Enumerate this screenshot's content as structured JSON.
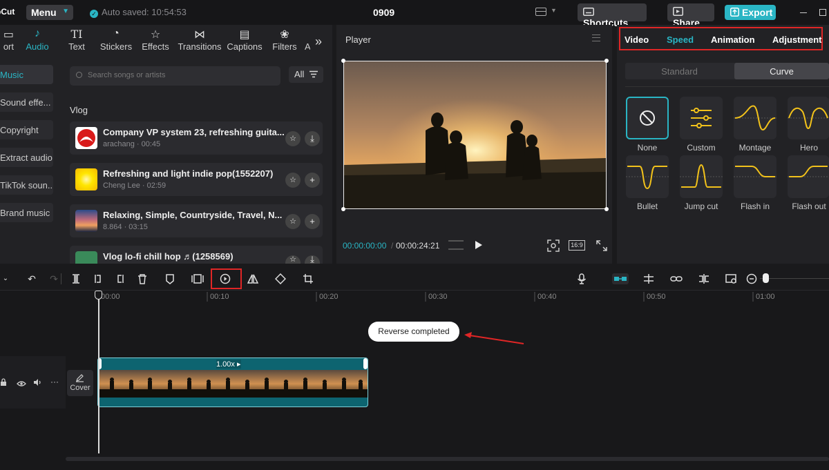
{
  "app": {
    "logo_text": "pCut",
    "project_name": "0909"
  },
  "topbar": {
    "menu_label": "Menu",
    "autosave": "Auto saved: 10:54:53",
    "shortcuts_label": "Shortcuts",
    "share_label": "Share",
    "export_label": "Export"
  },
  "left_tabs": [
    {
      "label": "ort",
      "icon": "import-icon"
    },
    {
      "label": "Audio",
      "icon": "audio-icon",
      "active": true
    },
    {
      "label": "Text",
      "icon": "text-icon"
    },
    {
      "label": "Stickers",
      "icon": "sticker-icon"
    },
    {
      "label": "Effects",
      "icon": "effects-icon"
    },
    {
      "label": "Transitions",
      "icon": "transitions-icon"
    },
    {
      "label": "Captions",
      "icon": "captions-icon"
    },
    {
      "label": "Filters",
      "icon": "filters-icon"
    }
  ],
  "audio_sidebar": [
    "Music",
    "Sound effe...",
    "Copyright",
    "Extract audio",
    "TikTok soun...",
    "Brand music"
  ],
  "search": {
    "placeholder": "Search songs or artists",
    "filter_label": "All"
  },
  "section_title": "Vlog",
  "tracks": [
    {
      "title": "Company VP system 23, refreshing guita...",
      "meta": "arachang · 00:45"
    },
    {
      "title": "Refreshing and light indie pop(1552207)",
      "meta": "Cheng Lee · 02:59"
    },
    {
      "title": "Relaxing, Simple, Countryside, Travel, N...",
      "meta": "8.864 · 03:15"
    },
    {
      "title": "Vlog  lo-fi chill hop ♬(1258569)",
      "meta": ""
    }
  ],
  "player": {
    "title": "Player",
    "current_time": "00:00:00:00",
    "separator": "/",
    "total_time": "00:00:24:21",
    "aspect": "16:9"
  },
  "right_panel": {
    "tabs": [
      "Video",
      "Speed",
      "Animation",
      "Adjustment"
    ],
    "active_tab": "Speed",
    "modes": [
      "Standard",
      "Curve"
    ],
    "active_mode": "Curve",
    "presets": [
      "None",
      "Custom",
      "Montage",
      "Hero",
      "Bullet",
      "Jump cut",
      "Flash in",
      "Flash out"
    ]
  },
  "timeline": {
    "ruler": [
      "00:00",
      "00:10",
      "00:20",
      "00:30",
      "00:40",
      "00:50",
      "01:00"
    ],
    "toast": "Reverse completed",
    "clip_speed": "1.00x",
    "cover_label": "Cover"
  },
  "colors": {
    "accent": "#2ab5c4",
    "highlight": "#e02626",
    "curve": "#f2c21b"
  }
}
